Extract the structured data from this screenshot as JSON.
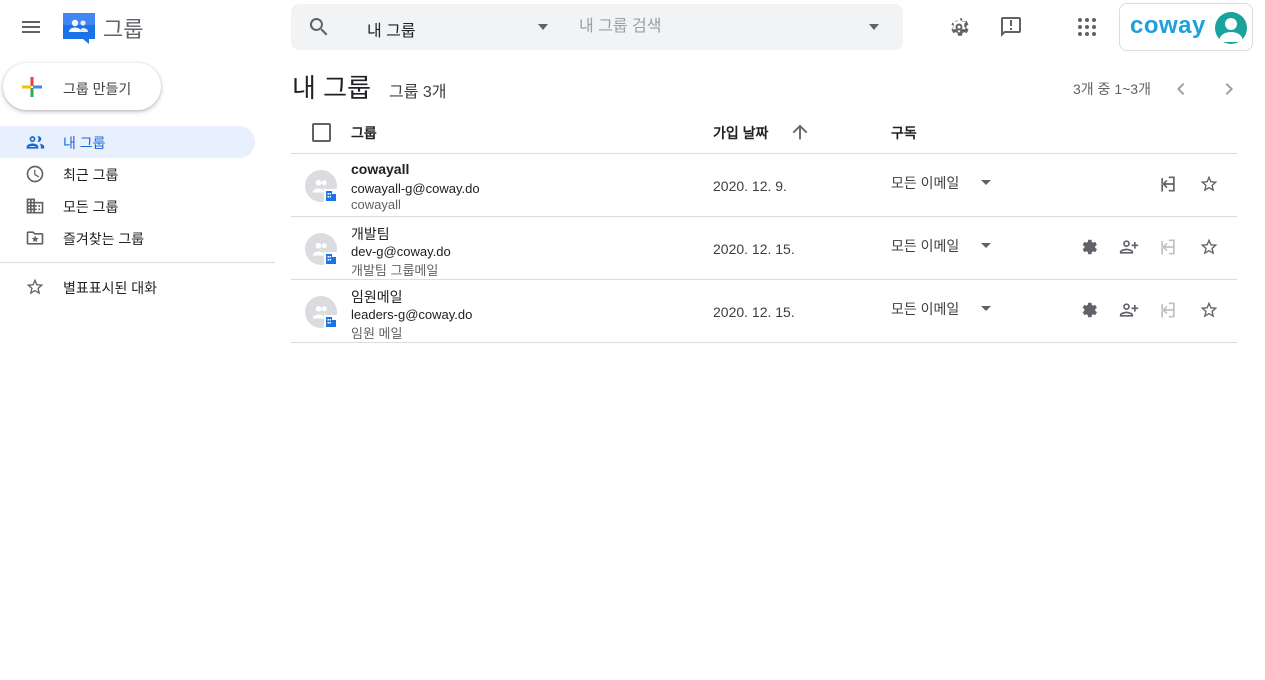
{
  "app": {
    "title": "그룹"
  },
  "search": {
    "scope_label": "내 그룹",
    "placeholder": "내 그룹 검색"
  },
  "account": {
    "brand_text": "coway"
  },
  "sidebar": {
    "create_label": "그룹 만들기",
    "items": [
      {
        "label": "내 그룹",
        "icon": "groups-icon",
        "active": true
      },
      {
        "label": "최근 그룹",
        "icon": "clock-icon",
        "active": false
      },
      {
        "label": "모든 그룹",
        "icon": "building-icon",
        "active": false
      },
      {
        "label": "즐겨찾는 그룹",
        "icon": "star-folder-icon",
        "active": false
      },
      {
        "label": "별표표시된 대화",
        "icon": "star-icon",
        "active": false
      }
    ]
  },
  "main": {
    "title": "내 그룹",
    "count": "그룹 3개",
    "pager": "3개 중 1~3개",
    "columns": {
      "group": "그룹",
      "date": "가입 날짜",
      "subscription": "구독"
    },
    "rows": [
      {
        "name": "cowayall",
        "email": "cowayall-g@coway.do",
        "desc": "cowayall",
        "date": "2020. 12. 9.",
        "subscription": "모든 이메일"
      },
      {
        "name": "개발팀",
        "email": "dev-g@coway.do",
        "desc": "개발팀 그룹메일",
        "date": "2020. 12. 15.",
        "subscription": "모든 이메일"
      },
      {
        "name": "임원메일",
        "email": "leaders-g@coway.do",
        "desc": "임원 메일",
        "date": "2020. 12. 15.",
        "subscription": "모든 이메일"
      }
    ]
  },
  "colors": {
    "accent": "#1967d2",
    "active_bg": "#e8f0fe",
    "brand": "#1ea0dc",
    "avatar": "#1aa39a"
  }
}
